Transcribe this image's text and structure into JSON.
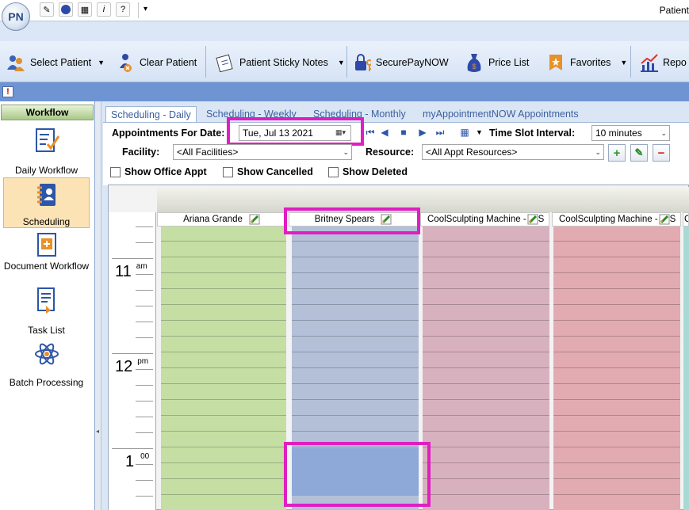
{
  "app": {
    "title": "Patient",
    "logo": "PN"
  },
  "toolbar": {
    "select_patient": "Select Patient",
    "clear_patient": "Clear Patient",
    "sticky_notes": "Patient Sticky Notes",
    "securepay": "SecurePayNOW",
    "price_list": "Price List",
    "favorites": "Favorites",
    "reports": "Repo"
  },
  "sidebar": {
    "header": "Workflow",
    "items": [
      {
        "label": "Daily Workflow"
      },
      {
        "label": "Scheduling"
      },
      {
        "label": "Document Workflow"
      },
      {
        "label": "Task List"
      },
      {
        "label": "Batch Processing"
      }
    ]
  },
  "tabs": [
    {
      "label": "Scheduling - Daily"
    },
    {
      "label": "Scheduling - Weekly"
    },
    {
      "label": "Scheduling - Monthly"
    },
    {
      "label": "myAppointmentNOW Appointments"
    }
  ],
  "filters": {
    "date_label": "Appointments For Date:",
    "date_value": "Tue,  Jul  13 2021",
    "interval_label": "Time Slot Interval:",
    "interval_value": "10 minutes",
    "facility_label": "Facility:",
    "facility_value": "<All Facilities>",
    "resource_label": "Resource:",
    "resource_value": "<All Appt Resources>",
    "show_office": "Show Office Appt",
    "show_cancelled": "Show Cancelled",
    "show_deleted": "Show Deleted"
  },
  "columns": [
    {
      "name": "Ariana Grande",
      "color": "#c5dea3"
    },
    {
      "name": "Britney Spears",
      "color": "#b4c0d8"
    },
    {
      "name": "CoolSculpting Machine -",
      "color": "#d8b1bf"
    },
    {
      "name": "CoolSculpting Machine -",
      "color": "#e2abb1"
    }
  ],
  "column_suffix": "S",
  "column_partial": "C",
  "times": [
    {
      "hour": "11",
      "ampm": "am"
    },
    {
      "hour": "12",
      "ampm": "pm"
    },
    {
      "hour": "1",
      "ampm": "00"
    }
  ],
  "colors": {
    "highlight": "#e01ec2",
    "selected_slot": "#8ea8d8"
  }
}
